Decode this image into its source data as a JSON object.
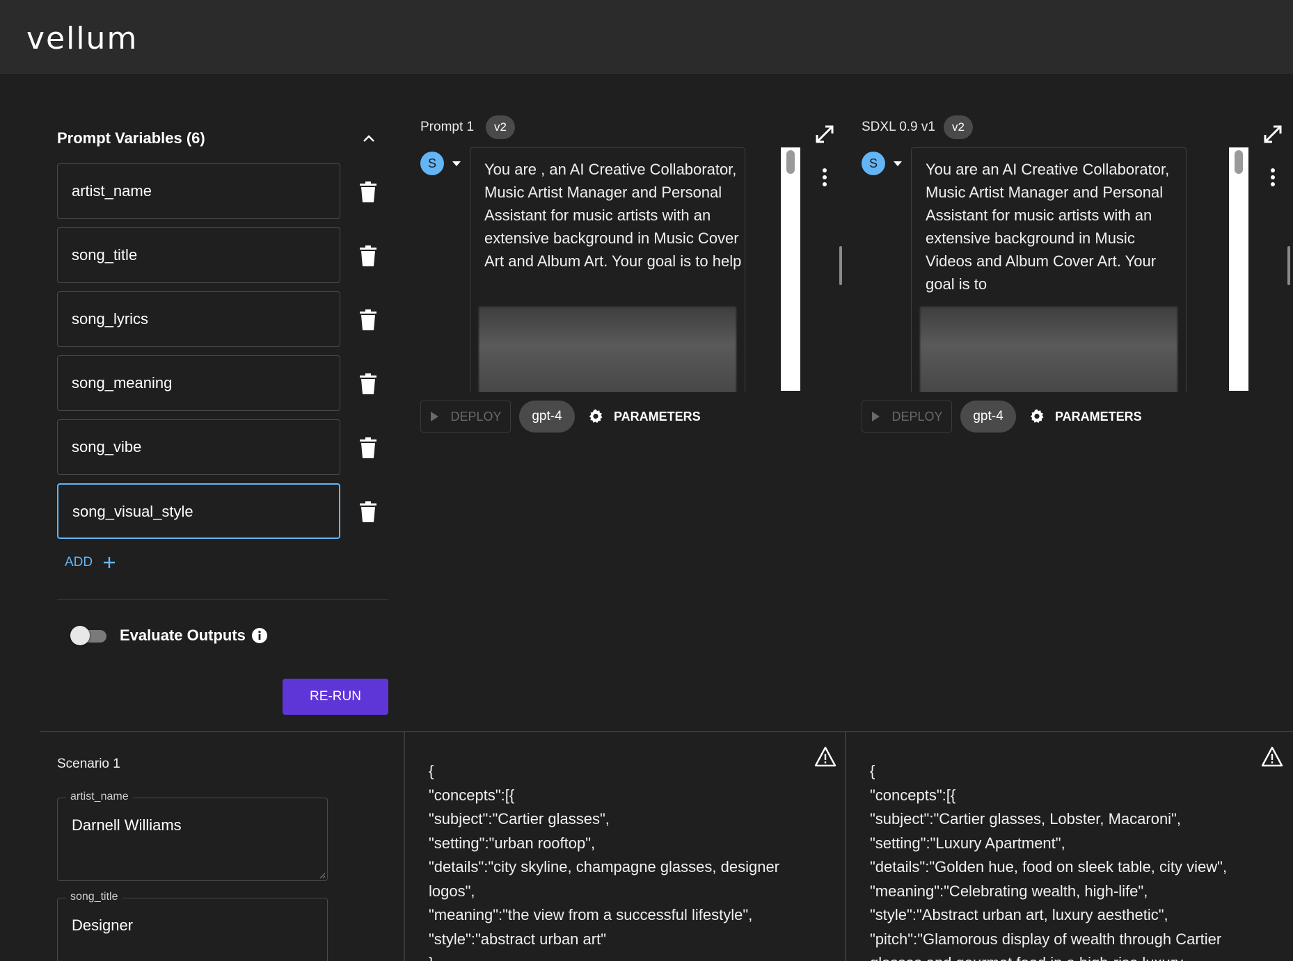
{
  "app": {
    "logo": "vellum"
  },
  "variables": {
    "title": "Prompt Variables (6)",
    "items": [
      {
        "name": "artist_name"
      },
      {
        "name": "song_title"
      },
      {
        "name": "song_lyrics"
      },
      {
        "name": "song_meaning"
      },
      {
        "name": "song_vibe"
      },
      {
        "name": "song_visual_style"
      }
    ],
    "add_label": "ADD",
    "evaluate_label": "Evaluate Outputs",
    "evaluate_enabled": false,
    "rerun_label": "RE-RUN"
  },
  "prompts": [
    {
      "title": "Prompt 1",
      "version": "v2",
      "avatar_initial": "S",
      "text": "You are          , an AI Creative Collaborator, Music Artist Manager and Personal Assistant for music artists with an extensive background in Music Cover Art and Album Art. Your goal is to help",
      "deploy_label": "DEPLOY",
      "model": "gpt-4",
      "params_label": "PARAMETERS"
    },
    {
      "title": "SDXL 0.9 v1",
      "version": "v2",
      "avatar_initial": "S",
      "text": "You are          an AI Creative Collaborator, Music Artist Manager and Personal Assistant for music artists with an extensive background in Music Videos and Album Cover Art. Your goal is to",
      "deploy_label": "DEPLOY",
      "model": "gpt-4",
      "params_label": "PARAMETERS"
    }
  ],
  "scenario": {
    "title": "Scenario 1",
    "fields": [
      {
        "label": "artist_name",
        "value": "Darnell Williams"
      },
      {
        "label": "song_title",
        "value": "Designer"
      }
    ]
  },
  "outputs": [
    {
      "text": "{\n\"concepts\":[{\n\"subject\":\"Cartier glasses\",\n\"setting\":\"urban rooftop\",\n\"details\":\"city skyline, champagne glasses, designer\nlogos\",\n\"meaning\":\"the view from a successful lifestyle\",\n\"style\":\"abstract urban art\"\n}"
    },
    {
      "text": "{\n\"concepts\":[{\n\"subject\":\"Cartier glasses, Lobster, Macaroni\",\n\"setting\":\"Luxury Apartment\",\n\"details\":\"Golden hue, food on sleek table, city view\",\n\"meaning\":\"Celebrating wealth, high-life\",\n\"style\":\"Abstract urban art, luxury aesthetic\",\n\"pitch\":\"Glamorous display of wealth through Cartier\nglasses and gourmet food in a high-rise luxury"
    }
  ],
  "colors": {
    "accent": "#5e35d6",
    "link": "#64b5f6",
    "background": "#1f1f1f",
    "topbar": "#2b2b2b"
  }
}
